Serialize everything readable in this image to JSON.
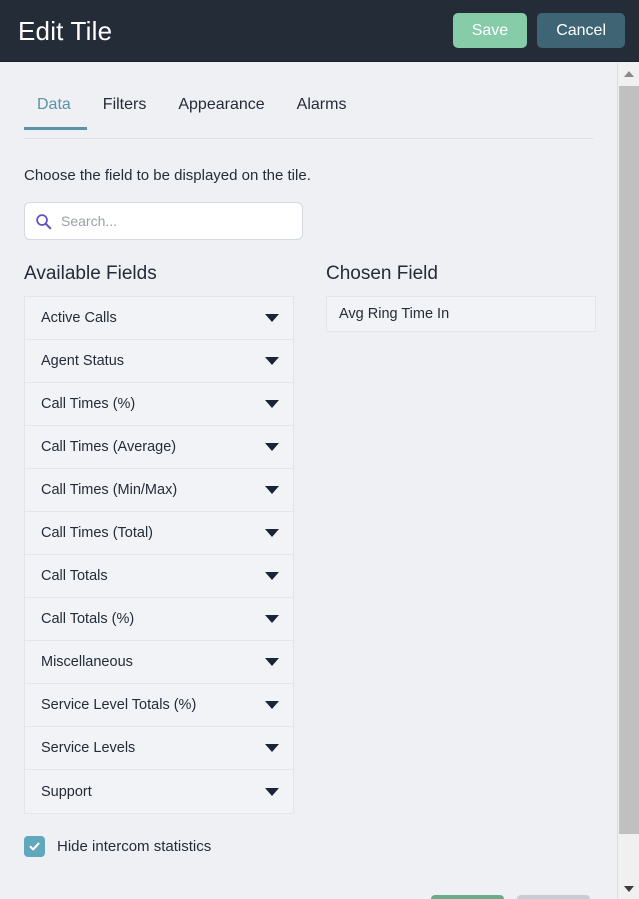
{
  "header": {
    "title": "Edit Tile",
    "save_label": "Save",
    "cancel_label": "Cancel",
    "background_color": "#242c38",
    "save_color": "#86cca8",
    "cancel_color": "#3f6574"
  },
  "tabs": {
    "active": "Data",
    "accent_color": "#5b93a8",
    "items": [
      {
        "label": "Data"
      },
      {
        "label": "Filters"
      },
      {
        "label": "Appearance"
      },
      {
        "label": "Alarms"
      }
    ]
  },
  "instruction": "Choose the field to be displayed on the tile.",
  "search": {
    "placeholder": "Search...",
    "value": "",
    "icon": "search-icon",
    "icon_color": "#5b4fc4"
  },
  "available": {
    "title": "Available Fields",
    "items": [
      {
        "label": "Active Calls",
        "icon": "chevron-down-icon"
      },
      {
        "label": "Agent Status",
        "icon": "chevron-down-icon"
      },
      {
        "label": "Call Times (%)",
        "icon": "chevron-down-icon"
      },
      {
        "label": "Call Times (Average)",
        "icon": "chevron-down-icon"
      },
      {
        "label": "Call Times (Min/Max)",
        "icon": "chevron-down-icon"
      },
      {
        "label": "Call Times (Total)",
        "icon": "chevron-down-icon"
      },
      {
        "label": "Call Totals",
        "icon": "chevron-down-icon"
      },
      {
        "label": "Call Totals (%)",
        "icon": "chevron-down-icon"
      },
      {
        "label": "Miscellaneous",
        "icon": "chevron-down-icon"
      },
      {
        "label": "Service Level Totals (%)",
        "icon": "chevron-down-icon"
      },
      {
        "label": "Service Levels",
        "icon": "chevron-down-icon"
      },
      {
        "label": "Support",
        "icon": "chevron-down-icon"
      }
    ]
  },
  "chosen": {
    "title": "Chosen Field",
    "items": [
      {
        "label": "Avg Ring Time In"
      }
    ]
  },
  "options": {
    "hide_intercom": {
      "label": "Hide intercom statistics",
      "checked": true,
      "checkbox_color": "#61a8bd"
    }
  },
  "scrollbar": {
    "up_icon": "triangle-up-icon",
    "down_icon": "triangle-down-icon"
  }
}
